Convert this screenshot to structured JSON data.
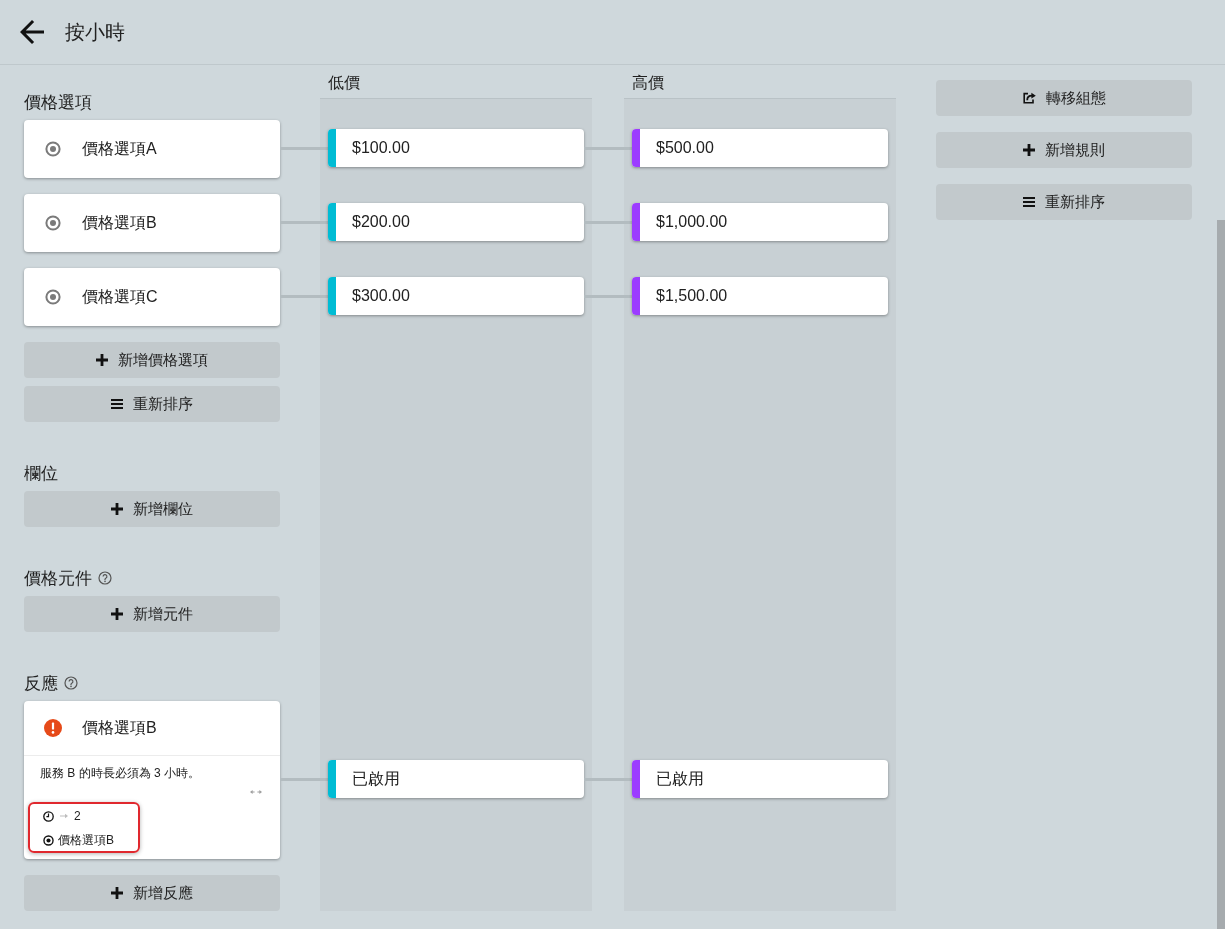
{
  "header": {
    "title": "按小時"
  },
  "price_options": {
    "title": "價格選項",
    "help": false,
    "items": [
      {
        "label": "價格選項A"
      },
      {
        "label": "價格選項B"
      },
      {
        "label": "價格選項C"
      }
    ],
    "buttons": [
      {
        "kind": "add",
        "label": "新增價格選項"
      },
      {
        "kind": "reorder",
        "label": "重新排序"
      }
    ]
  },
  "fields": {
    "title": "欄位",
    "help": false,
    "buttons": [
      {
        "kind": "add",
        "label": "新增欄位"
      }
    ]
  },
  "price_components": {
    "title": "價格元件",
    "help": true,
    "buttons": [
      {
        "kind": "add",
        "label": "新增元件"
      }
    ]
  },
  "reactions": {
    "title": "反應",
    "help": true,
    "items": [
      {
        "title": "價格選項B",
        "error": true,
        "description": "服務 B 的時長必須為 3 小時。",
        "highlighted": true,
        "conditions": [
          {
            "kind": "duration",
            "value": "2"
          },
          {
            "kind": "option",
            "value": "價格選項B"
          }
        ]
      }
    ],
    "buttons": [
      {
        "kind": "add",
        "label": "新增反應"
      }
    ]
  },
  "columns": [
    {
      "title": "低價",
      "color": "#00bcd4",
      "cells": [
        "$100.00",
        "$200.00",
        "$300.00"
      ],
      "reaction_cells": [
        "已啟用"
      ]
    },
    {
      "title": "高價",
      "color": "#9c3cff",
      "cells": [
        "$500.00",
        "$1,000.00",
        "$1,500.00"
      ],
      "reaction_cells": [
        "已啟用"
      ]
    }
  ],
  "actions": [
    {
      "kind": "transfer",
      "label": "轉移組態"
    },
    {
      "kind": "add",
      "label": "新增規則"
    },
    {
      "kind": "reorder",
      "label": "重新排序"
    }
  ]
}
